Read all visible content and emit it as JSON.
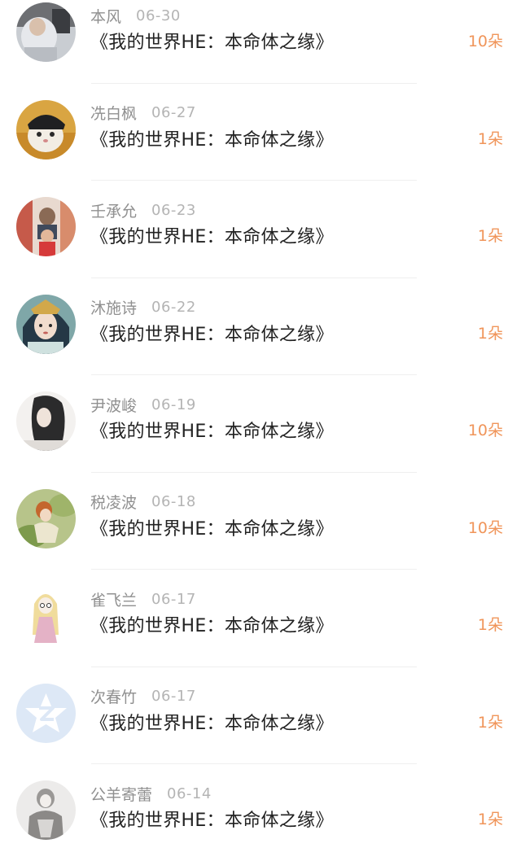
{
  "accent_color": "#f0955a",
  "records": [
    {
      "name": "本风",
      "date": "06-30",
      "title": "《我的世界HE：本命体之缘》",
      "amount": "10朵",
      "avatar": "photo-avatar-icon"
    },
    {
      "name": "冼白枫",
      "date": "06-27",
      "title": "《我的世界HE：本命体之缘》",
      "amount": "1朵",
      "avatar": "cat-avatar-icon"
    },
    {
      "name": "壬承允",
      "date": "06-23",
      "title": "《我的世界HE：本命体之缘》",
      "amount": "1朵",
      "avatar": "photo-avatar-icon"
    },
    {
      "name": "沐施诗",
      "date": "06-22",
      "title": "《我的世界HE：本命体之缘》",
      "amount": "1朵",
      "avatar": "illustration-avatar-icon"
    },
    {
      "name": "尹波峻",
      "date": "06-19",
      "title": "《我的世界HE：本命体之缘》",
      "amount": "10朵",
      "avatar": "photo-avatar-icon"
    },
    {
      "name": "税凌波",
      "date": "06-18",
      "title": "《我的世界HE：本命体之缘》",
      "amount": "10朵",
      "avatar": "illustration-avatar-icon"
    },
    {
      "name": "雀飞兰",
      "date": "06-17",
      "title": "《我的世界HE：本命体之缘》",
      "amount": "1朵",
      "avatar": "cartoon-girl-avatar-icon"
    },
    {
      "name": "次春竹",
      "date": "06-17",
      "title": "《我的世界HE：本命体之缘》",
      "amount": "1朵",
      "avatar": "default-avatar-icon"
    },
    {
      "name": "公羊寄蕾",
      "date": "06-14",
      "title": "《我的世界HE：本命体之缘》",
      "amount": "1朵",
      "avatar": "sketch-avatar-icon"
    }
  ]
}
